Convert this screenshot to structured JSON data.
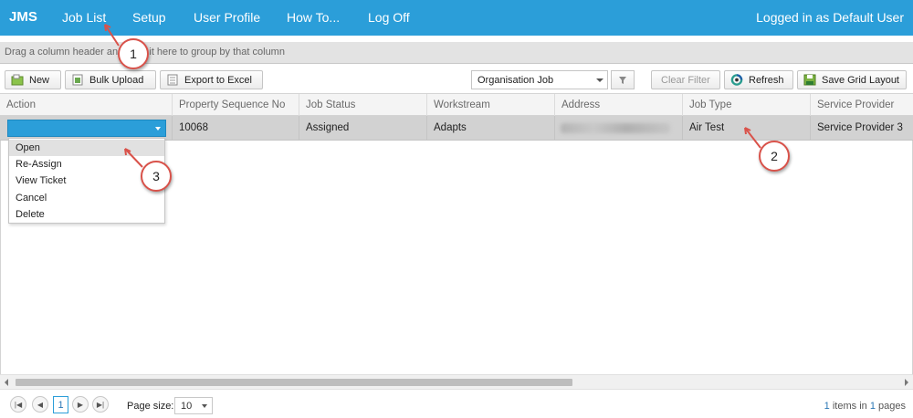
{
  "nav": {
    "brand": "JMS",
    "items": [
      "Job List",
      "Setup",
      "User Profile",
      "How To...",
      "Log Off"
    ],
    "login_status": "Logged in as Default User"
  },
  "group_panel": {
    "text": "Drag a column header and drop it here to group by that column"
  },
  "toolbar": {
    "new_label": "New",
    "bulk_upload_label": "Bulk Upload",
    "export_label": "Export to Excel",
    "view_select_value": "Organisation Job",
    "clear_filter_label": "Clear Filter",
    "refresh_label": "Refresh",
    "save_layout_label": "Save Grid Layout"
  },
  "grid": {
    "columns": [
      "Action",
      "Property Sequence No",
      "Job Status",
      "Workstream",
      "Address",
      "Job Type",
      "Service Provider"
    ],
    "rows": [
      {
        "property_sequence_no": "10068",
        "job_status": "Assigned",
        "workstream": "Adapts",
        "address": "",
        "job_type": "Air Test",
        "service_provider": "Service Provider 3"
      }
    ]
  },
  "action_menu": {
    "items": [
      "Open",
      "Re-Assign",
      "View Ticket",
      "Cancel",
      "Delete"
    ],
    "highlighted_index": 0
  },
  "pager": {
    "current_page": "1",
    "page_size_label": "Page size:",
    "page_size": "10",
    "items_count": "1",
    "items_text": "items in",
    "pages_count": "1",
    "pages_text": "pages"
  },
  "callouts": [
    "1",
    "2",
    "3"
  ],
  "colors": {
    "accent": "#2b9ed9",
    "callout_border": "#d9524a"
  },
  "icons": [
    "new-icon",
    "bulk-upload-icon",
    "excel-icon",
    "filter-icon",
    "refresh-icon",
    "save-layout-icon"
  ]
}
